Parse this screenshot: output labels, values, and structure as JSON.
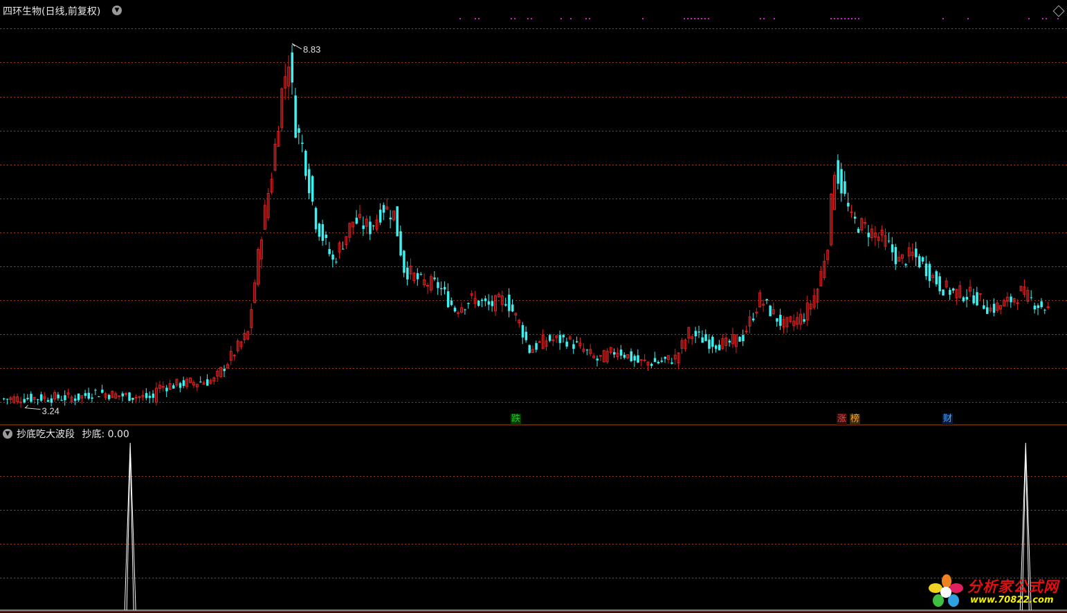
{
  "header": {
    "title": "四环生物(日线,前复权)",
    "high_label": "8.83",
    "low_label": "3.24"
  },
  "indicator": {
    "name": "抄底吃大波段",
    "label": "抄底:",
    "value": "0.00"
  },
  "tags": [
    {
      "text": "跌",
      "color": "#20c020",
      "bg": "#0a3a0a"
    },
    {
      "text": "涨",
      "color": "#ff4040",
      "bg": "#3a0a0a"
    },
    {
      "text": "榜",
      "color": "#ffa020",
      "bg": "#3a2a0a"
    },
    {
      "text": "财",
      "color": "#4da6ff",
      "bg": "#0a1a3a"
    }
  ],
  "logo": {
    "name": "分析家公式网",
    "url": "www.70822.com"
  },
  "colors": {
    "up": "#e02020",
    "down": "#3ff0f0",
    "grid": "#a04010",
    "signal": "#ffffff",
    "dots": "#d020d0"
  },
  "chart_data": [
    {
      "type": "candlestick",
      "ylim": [
        2.9,
        9.15
      ],
      "hline_levels": [
        3.24,
        3.73,
        4.23,
        4.73,
        5.23,
        5.73,
        6.23,
        6.73,
        7.23,
        7.73,
        8.23,
        8.73
      ],
      "anchors": [
        [
          0,
          3.28
        ],
        [
          12,
          3.3
        ],
        [
          22,
          3.3
        ],
        [
          27,
          3.38
        ],
        [
          34,
          3.33
        ],
        [
          38,
          3.32
        ],
        [
          44,
          3.29
        ],
        [
          45,
          3.45
        ],
        [
          55,
          3.52
        ],
        [
          62,
          3.55
        ],
        [
          67,
          3.9
        ],
        [
          72,
          4.25
        ],
        [
          76,
          5.75
        ],
        [
          79,
          6.6
        ],
        [
          82,
          7.8
        ],
        [
          84,
          8.3
        ],
        [
          86,
          7.3
        ],
        [
          88,
          7.0
        ],
        [
          92,
          5.9
        ],
        [
          97,
          5.3
        ],
        [
          103,
          5.9
        ],
        [
          108,
          5.8
        ],
        [
          112,
          6.1
        ],
        [
          115,
          6.0
        ],
        [
          118,
          5.2
        ],
        [
          123,
          5.0
        ],
        [
          128,
          4.95
        ],
        [
          133,
          4.6
        ],
        [
          138,
          4.75
        ],
        [
          143,
          4.65
        ],
        [
          148,
          4.75
        ],
        [
          152,
          4.4
        ],
        [
          155,
          4.0
        ],
        [
          160,
          4.15
        ],
        [
          166,
          4.15
        ],
        [
          171,
          4.0
        ],
        [
          175,
          3.85
        ],
        [
          181,
          4.0
        ],
        [
          187,
          3.82
        ],
        [
          193,
          3.82
        ],
        [
          198,
          3.88
        ],
        [
          202,
          4.25
        ],
        [
          208,
          4.12
        ],
        [
          213,
          4.08
        ],
        [
          218,
          4.2
        ],
        [
          223,
          4.75
        ],
        [
          230,
          4.35
        ],
        [
          236,
          4.5
        ],
        [
          240,
          4.9
        ],
        [
          243,
          5.6
        ],
        [
          245,
          6.7
        ],
        [
          247,
          6.4
        ],
        [
          250,
          5.9
        ],
        [
          254,
          5.8
        ],
        [
          260,
          5.6
        ],
        [
          264,
          5.3
        ],
        [
          268,
          5.4
        ],
        [
          272,
          5.2
        ],
        [
          276,
          4.95
        ],
        [
          280,
          4.85
        ],
        [
          286,
          4.8
        ],
        [
          291,
          4.6
        ],
        [
          296,
          4.7
        ],
        [
          300,
          4.85
        ],
        [
          304,
          4.7
        ],
        [
          308,
          4.6
        ]
      ]
    },
    {
      "type": "line",
      "name": "抄底",
      "x_count": 309,
      "spikes": [
        37,
        297
      ],
      "ylim": [
        0,
        1
      ]
    }
  ]
}
